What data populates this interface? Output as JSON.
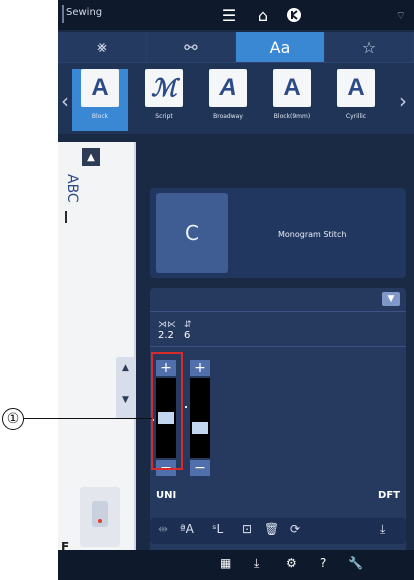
{
  "status": {
    "mode": "Sewing",
    "icons": [
      "menu-icon",
      "home-icon",
      "stop-icon",
      "wifi-icon"
    ]
  },
  "category_tabs": [
    {
      "icon": "utility-stitch-icon",
      "label": "⨳"
    },
    {
      "icon": "decorative-stitch-icon",
      "label": "⚯"
    },
    {
      "icon": "alphabet-icon",
      "label": "Aa",
      "active": true
    },
    {
      "icon": "favorites-icon",
      "label": "☆"
    }
  ],
  "fonts": [
    {
      "glyph": "A",
      "label": "Block",
      "active": true
    },
    {
      "glyph": "ℳ",
      "label": "Script"
    },
    {
      "glyph": "A",
      "label": "Broadway"
    },
    {
      "glyph": "A",
      "label": "Block(9mm)"
    },
    {
      "glyph": "A",
      "label": "Cyrillic"
    }
  ],
  "left_panel": {
    "abc_text": "ABC",
    "foot_letter": "F"
  },
  "monogram": {
    "letter": "C",
    "name": "Monogram Stitch"
  },
  "params": {
    "width_value": "2.2",
    "length_value": "6"
  },
  "uni_label": "UNI",
  "dft_label": "DFT",
  "sliders": {
    "left_level": 0.5,
    "right_level": 0.35
  },
  "callout": {
    "number": "①"
  },
  "accent": "#3a87d4",
  "highlight_color": "#d62c2c"
}
